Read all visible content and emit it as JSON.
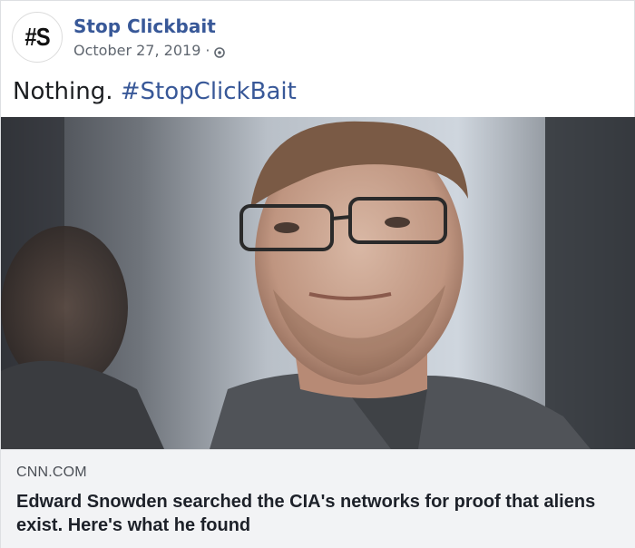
{
  "post": {
    "avatar_text": "#S",
    "page_name": "Stop Clickbait",
    "date": "October 27, 2019",
    "separator": "·",
    "privacy_icon": "globe-icon",
    "text_plain": "Nothing.",
    "text_hashtag": "#StopClickBait"
  },
  "link_preview": {
    "domain": "CNN.COM",
    "title": "Edward Snowden searched the CIA's networks for proof that aliens exist. Here's what he found",
    "image": "photo-of-man-with-glasses"
  },
  "colors": {
    "link_blue": "#385898",
    "secondary_text": "#606770",
    "card_background": "#f2f3f5"
  }
}
